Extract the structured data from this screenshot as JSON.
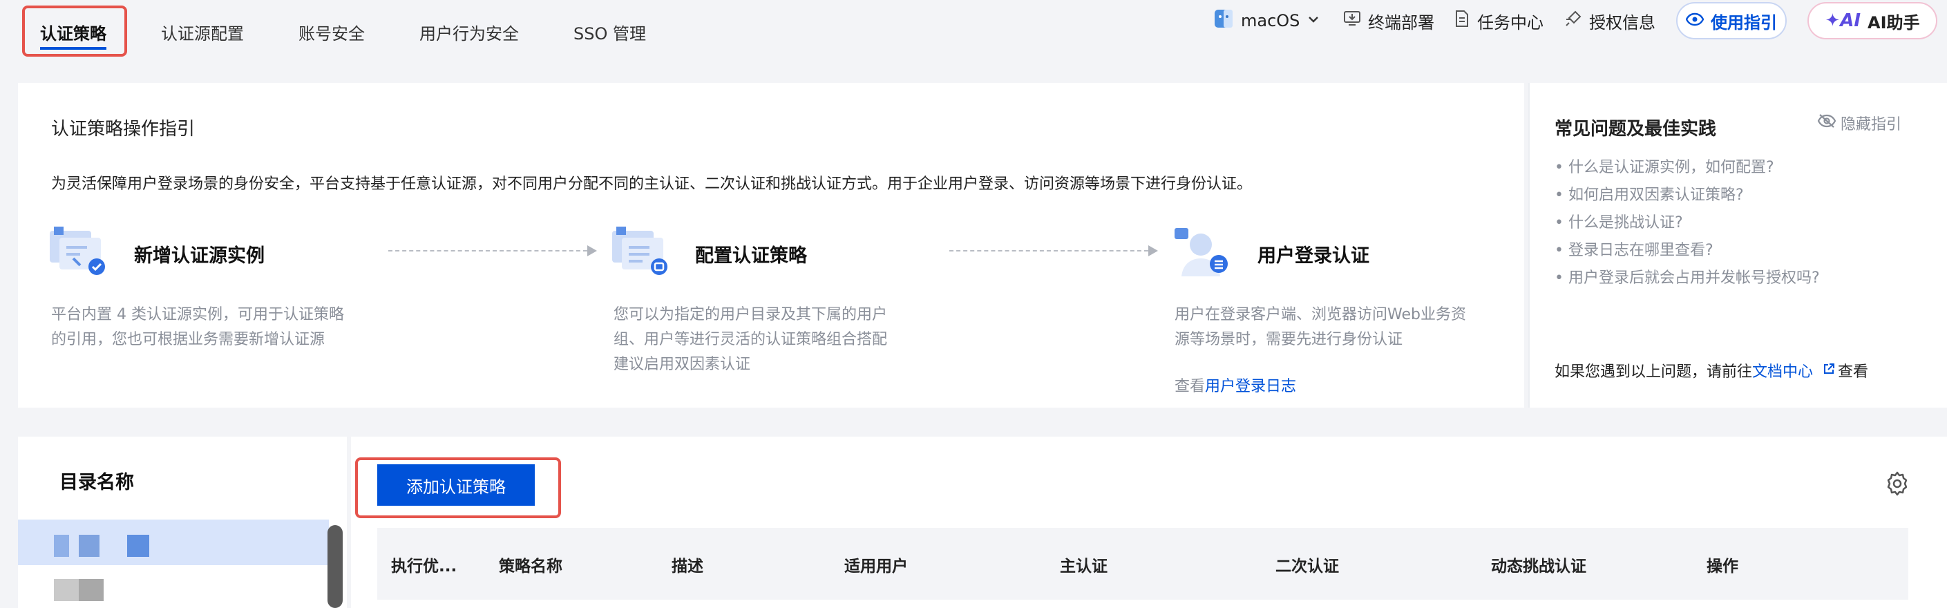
{
  "tabs": [
    {
      "label": "认证策略",
      "active": true
    },
    {
      "label": "认证源配置"
    },
    {
      "label": "账号安全"
    },
    {
      "label": "用户行为安全"
    },
    {
      "label": "SSO 管理"
    }
  ],
  "topbar": {
    "os_label": "macOS",
    "deploy_label": "终端部署",
    "tasks_label": "任务中心",
    "license_label": "授权信息",
    "guide_button": "使用指引",
    "ai_button": "AI助手",
    "ai_badge": "AI"
  },
  "guide": {
    "title": "认证策略操作指引",
    "description": "为灵活保障用户登录场景的身份安全，平台支持基于任意认证源，对不同用户分配不同的主认证、二次认证和挑战认证方式。用于企业用户登录、访问资源等场景下进行身份认证。",
    "steps": [
      {
        "title": "新增认证源实例",
        "desc": [
          "平台内置 4 类认证源实例，可用于认证策略",
          "的引用，您也可根据业务需要新增认证源"
        ]
      },
      {
        "title": "配置认证策略",
        "desc": [
          "您可以为指定的用户目录及其下属的用户",
          "组、用户等进行灵活的认证策略组合搭配",
          "建议启用双因素认证"
        ]
      },
      {
        "title": "用户登录认证",
        "desc": [
          "用户在登录客户端、浏览器访问Web业务资",
          "源等场景时，需要先进行身份认证"
        ],
        "link_prefix": "查看",
        "link_text": "用户登录日志"
      }
    ]
  },
  "faq": {
    "title": "常见问题及最佳实践",
    "hide_label": "隐藏指引",
    "items": [
      "• 什么是认证源实例，如何配置?",
      "• 如何启用双因素认证策略?",
      "• 什么是挑战认证?",
      "• 登录日志在哪里查看?",
      "• 用户登录后就会占用并发帐号授权吗?"
    ],
    "footer_prefix": "如果您遇到以上问题，请前往",
    "footer_link": "文档中心",
    "footer_suffix": "查看"
  },
  "directory": {
    "title": "目录名称"
  },
  "policies": {
    "add_button": "添加认证策略",
    "columns": [
      "执行优...",
      "策略名称",
      "描述",
      "适用用户",
      "主认证",
      "二次认证",
      "动态挑战认证",
      "操作"
    ]
  },
  "colors": {
    "accent": "#0052d9",
    "highlight": "#e5534b",
    "page_bg": "#f3f4f7"
  }
}
